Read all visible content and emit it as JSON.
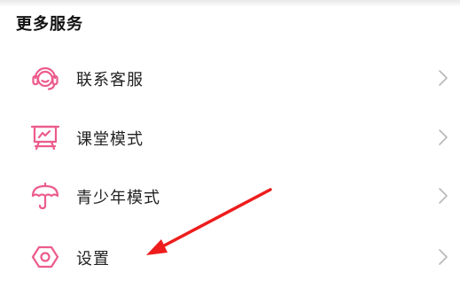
{
  "section": {
    "title": "更多服务"
  },
  "menu": {
    "items": [
      {
        "label": "联系客服",
        "icon": "headset-icon"
      },
      {
        "label": "课堂模式",
        "icon": "blackboard-icon"
      },
      {
        "label": "青少年模式",
        "icon": "umbrella-icon"
      },
      {
        "label": "设置",
        "icon": "hexagon-settings-icon"
      }
    ]
  },
  "colors": {
    "accent": "#ec5b8c",
    "chevron": "#b8b8b8",
    "annotation_arrow": "#ee1c1c"
  }
}
